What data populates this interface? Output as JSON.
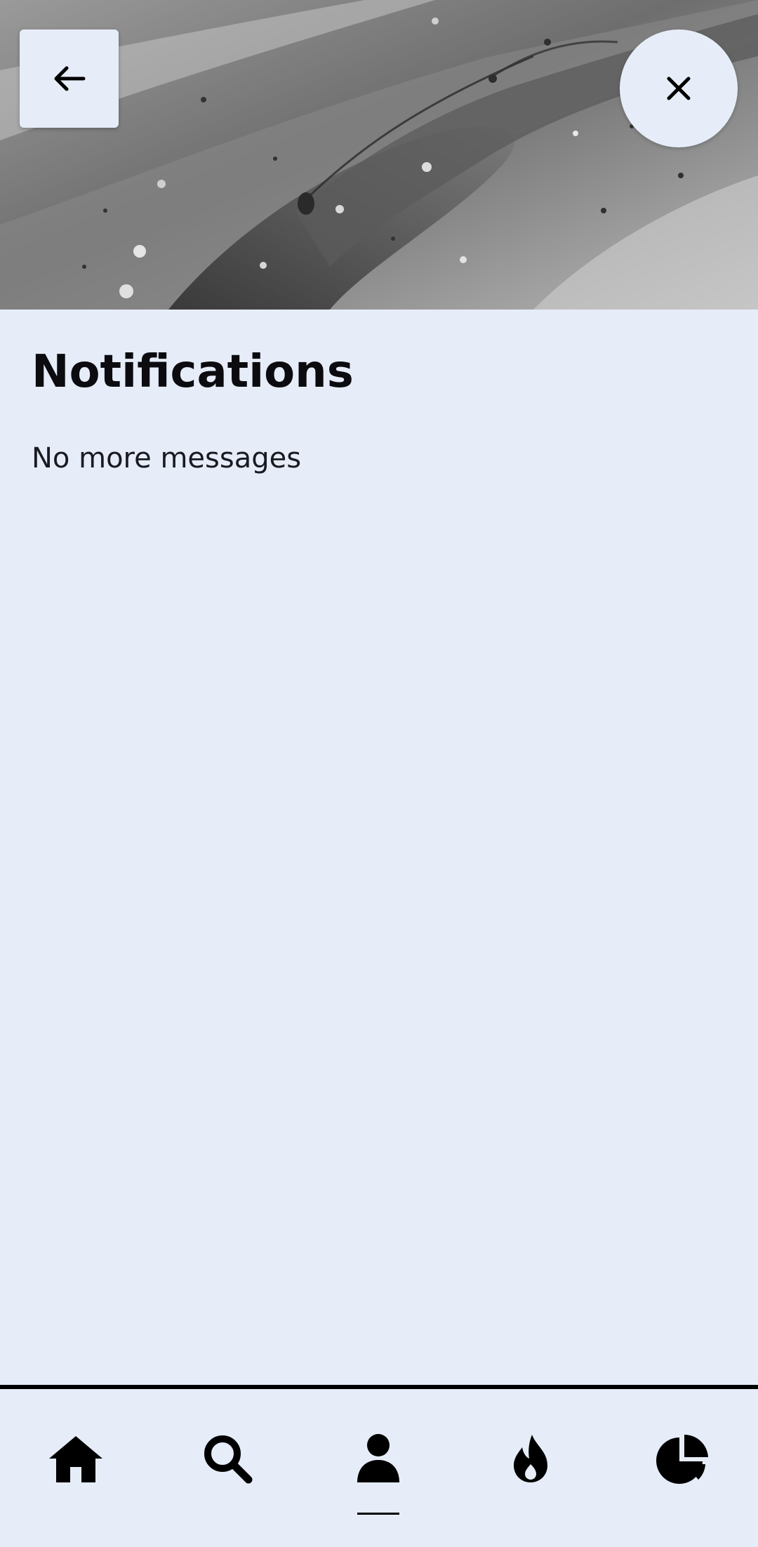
{
  "header": {
    "back_icon": "arrow-left-icon",
    "close_icon": "close-icon"
  },
  "main": {
    "title": "Notifications",
    "empty_message": "No more messages"
  },
  "bottom_nav": {
    "items": [
      {
        "icon": "home-icon",
        "active": false
      },
      {
        "icon": "search-icon",
        "active": false
      },
      {
        "icon": "profile-icon",
        "active": true
      },
      {
        "icon": "fire-icon",
        "active": false
      },
      {
        "icon": "pie-chart-icon",
        "active": false
      }
    ]
  },
  "colors": {
    "background": "#e6edf8",
    "text": "#0c0c10",
    "accent": "#000000"
  }
}
